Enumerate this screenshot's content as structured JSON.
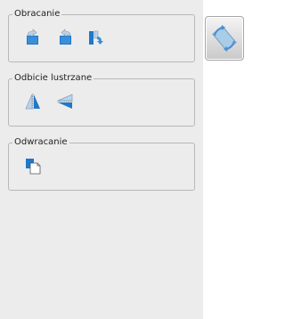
{
  "groups": {
    "rotate": {
      "label": "Obracanie",
      "icons": [
        "rotate-left-icon",
        "rotate-right-icon",
        "rotate-flip-icon"
      ]
    },
    "mirror": {
      "label": "Odbicie lustrzane",
      "icons": [
        "mirror-vertical-icon",
        "mirror-horizontal-icon"
      ]
    },
    "flip": {
      "label": "Odwracanie",
      "icons": [
        "flip-layers-icon"
      ]
    }
  },
  "side_button": {
    "icon": "rotate-tool-icon"
  },
  "colors": {
    "panel": "#ececec",
    "border": "#b8b8b8",
    "icon_blue": "#1f78c8",
    "icon_light": "#a9cde8"
  }
}
